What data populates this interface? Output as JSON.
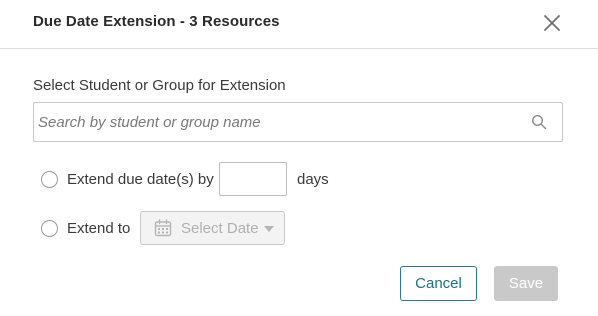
{
  "dialog": {
    "title": "Due Date Extension - 3 Resources",
    "close_icon": "close-icon"
  },
  "student_select": {
    "label": "Select Student or Group for Extension",
    "search_placeholder": "Search by student or group name",
    "search_value": "",
    "search_icon": "search-icon"
  },
  "options": {
    "extend_by": {
      "label": "Extend due date(s) by",
      "days_value": "",
      "suffix": "days",
      "selected": false
    },
    "extend_to": {
      "label": "Extend to",
      "date_placeholder": "Select Date",
      "calendar_icon": "calendar-icon",
      "dropdown_icon": "caret-down-icon",
      "selected": false,
      "disabled": true
    }
  },
  "footer": {
    "cancel_label": "Cancel",
    "save_label": "Save",
    "save_disabled": true
  },
  "colors": {
    "accent": "#1f6f82",
    "disabled_button": "#c9c9c9",
    "divider": "#dcdcdc",
    "text": "#333333"
  }
}
